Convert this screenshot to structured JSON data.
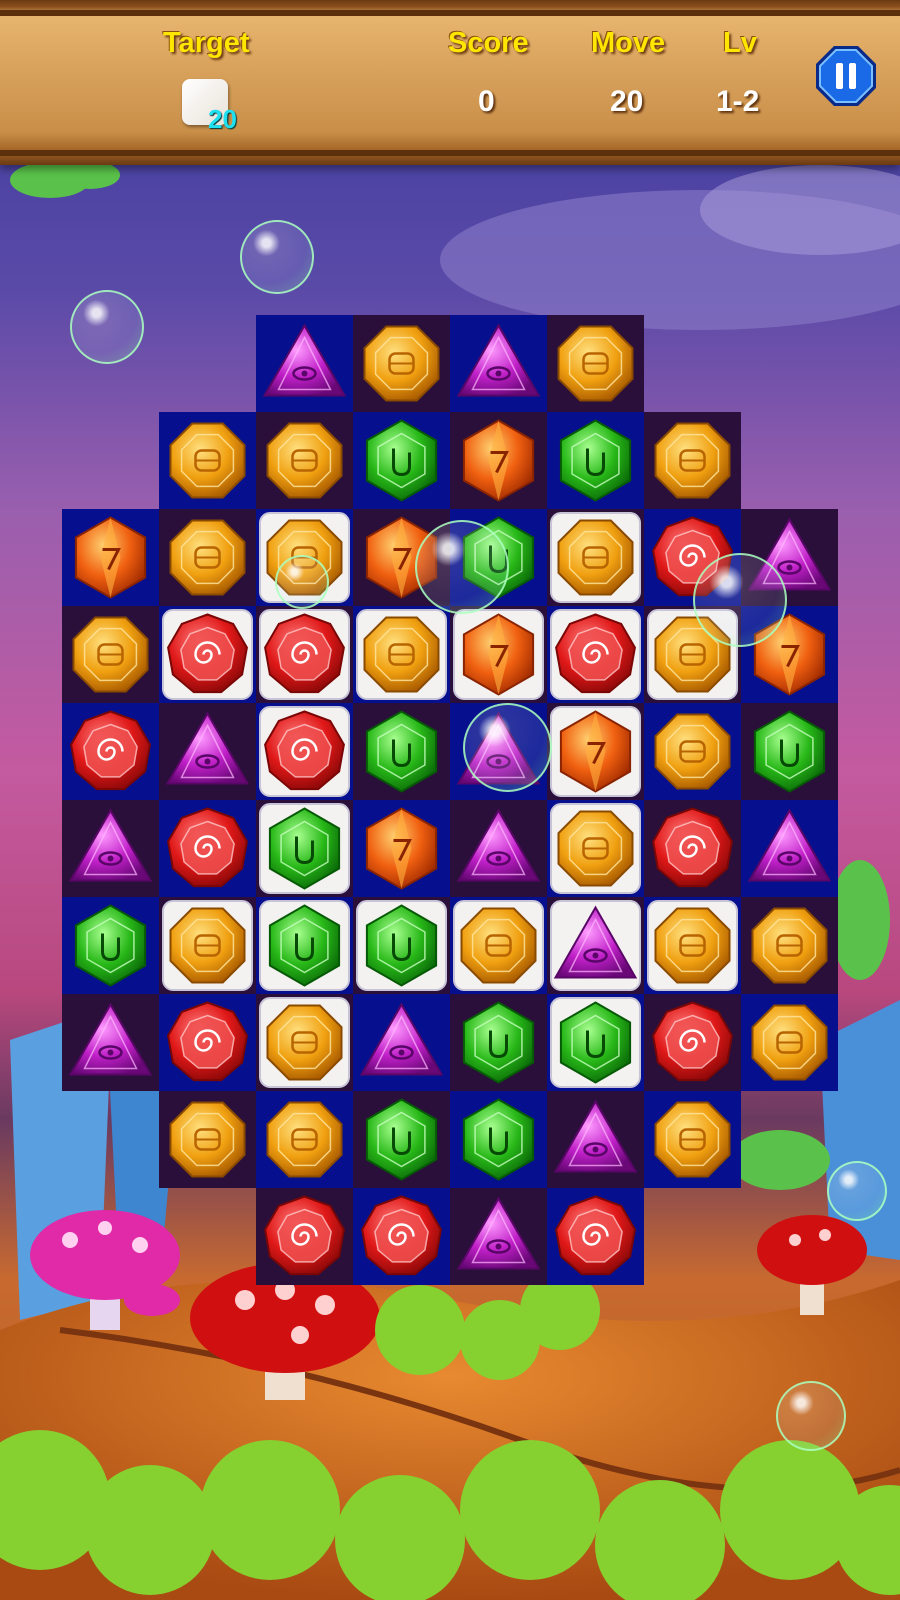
{
  "hud": {
    "target_label": "Target",
    "target_count": "20",
    "score_label": "Score",
    "score_value": "0",
    "move_label": "Move",
    "move_value": "20",
    "level_label": "Lv",
    "level_value": "1-2"
  },
  "board": {
    "columns": 8,
    "rows": [
      [
        null,
        null,
        "purple",
        "orange",
        "purple",
        "orange",
        null,
        null
      ],
      [
        null,
        "orange",
        "orange",
        "green",
        "amber",
        "green",
        "orange",
        null
      ],
      [
        "amber",
        "orange",
        "orange",
        "amber",
        "green",
        "orange",
        "red",
        "purple"
      ],
      [
        "orange",
        "red",
        "red",
        "orange",
        "amber",
        "red",
        "orange",
        "amber"
      ],
      [
        "red",
        "purple",
        "red",
        "green",
        "purple",
        "amber",
        "orange",
        "green"
      ],
      [
        "purple",
        "red",
        "green",
        "amber",
        "purple",
        "orange",
        "red",
        "purple"
      ],
      [
        "green",
        "orange",
        "green",
        "green",
        "orange",
        "purple",
        "orange",
        "orange"
      ],
      [
        "purple",
        "red",
        "orange",
        "purple",
        "green",
        "green",
        "red",
        "orange"
      ],
      [
        null,
        "orange",
        "orange",
        "green",
        "green",
        "purple",
        "orange",
        null
      ],
      [
        null,
        null,
        "red",
        "red",
        "purple",
        "red",
        null,
        null
      ]
    ],
    "ice": [
      [
        0,
        0,
        0,
        0,
        0,
        0,
        0,
        0
      ],
      [
        0,
        0,
        0,
        0,
        0,
        0,
        0,
        0
      ],
      [
        0,
        0,
        1,
        0,
        0,
        1,
        0,
        0
      ],
      [
        0,
        1,
        1,
        1,
        1,
        1,
        1,
        0
      ],
      [
        0,
        0,
        1,
        0,
        0,
        1,
        0,
        0
      ],
      [
        0,
        0,
        1,
        0,
        0,
        1,
        0,
        0
      ],
      [
        0,
        1,
        1,
        1,
        1,
        1,
        1,
        0
      ],
      [
        0,
        0,
        1,
        0,
        0,
        1,
        0,
        0
      ],
      [
        0,
        0,
        0,
        0,
        0,
        0,
        0,
        0
      ],
      [
        0,
        0,
        0,
        0,
        0,
        0,
        0,
        0
      ]
    ]
  },
  "colors": {
    "tile_blue": "#06108e",
    "tile_dark": "#2a0f3a",
    "ice": "#f4f2f0",
    "label_yellow": "#ffe600",
    "count_cyan": "#20e0f0"
  }
}
